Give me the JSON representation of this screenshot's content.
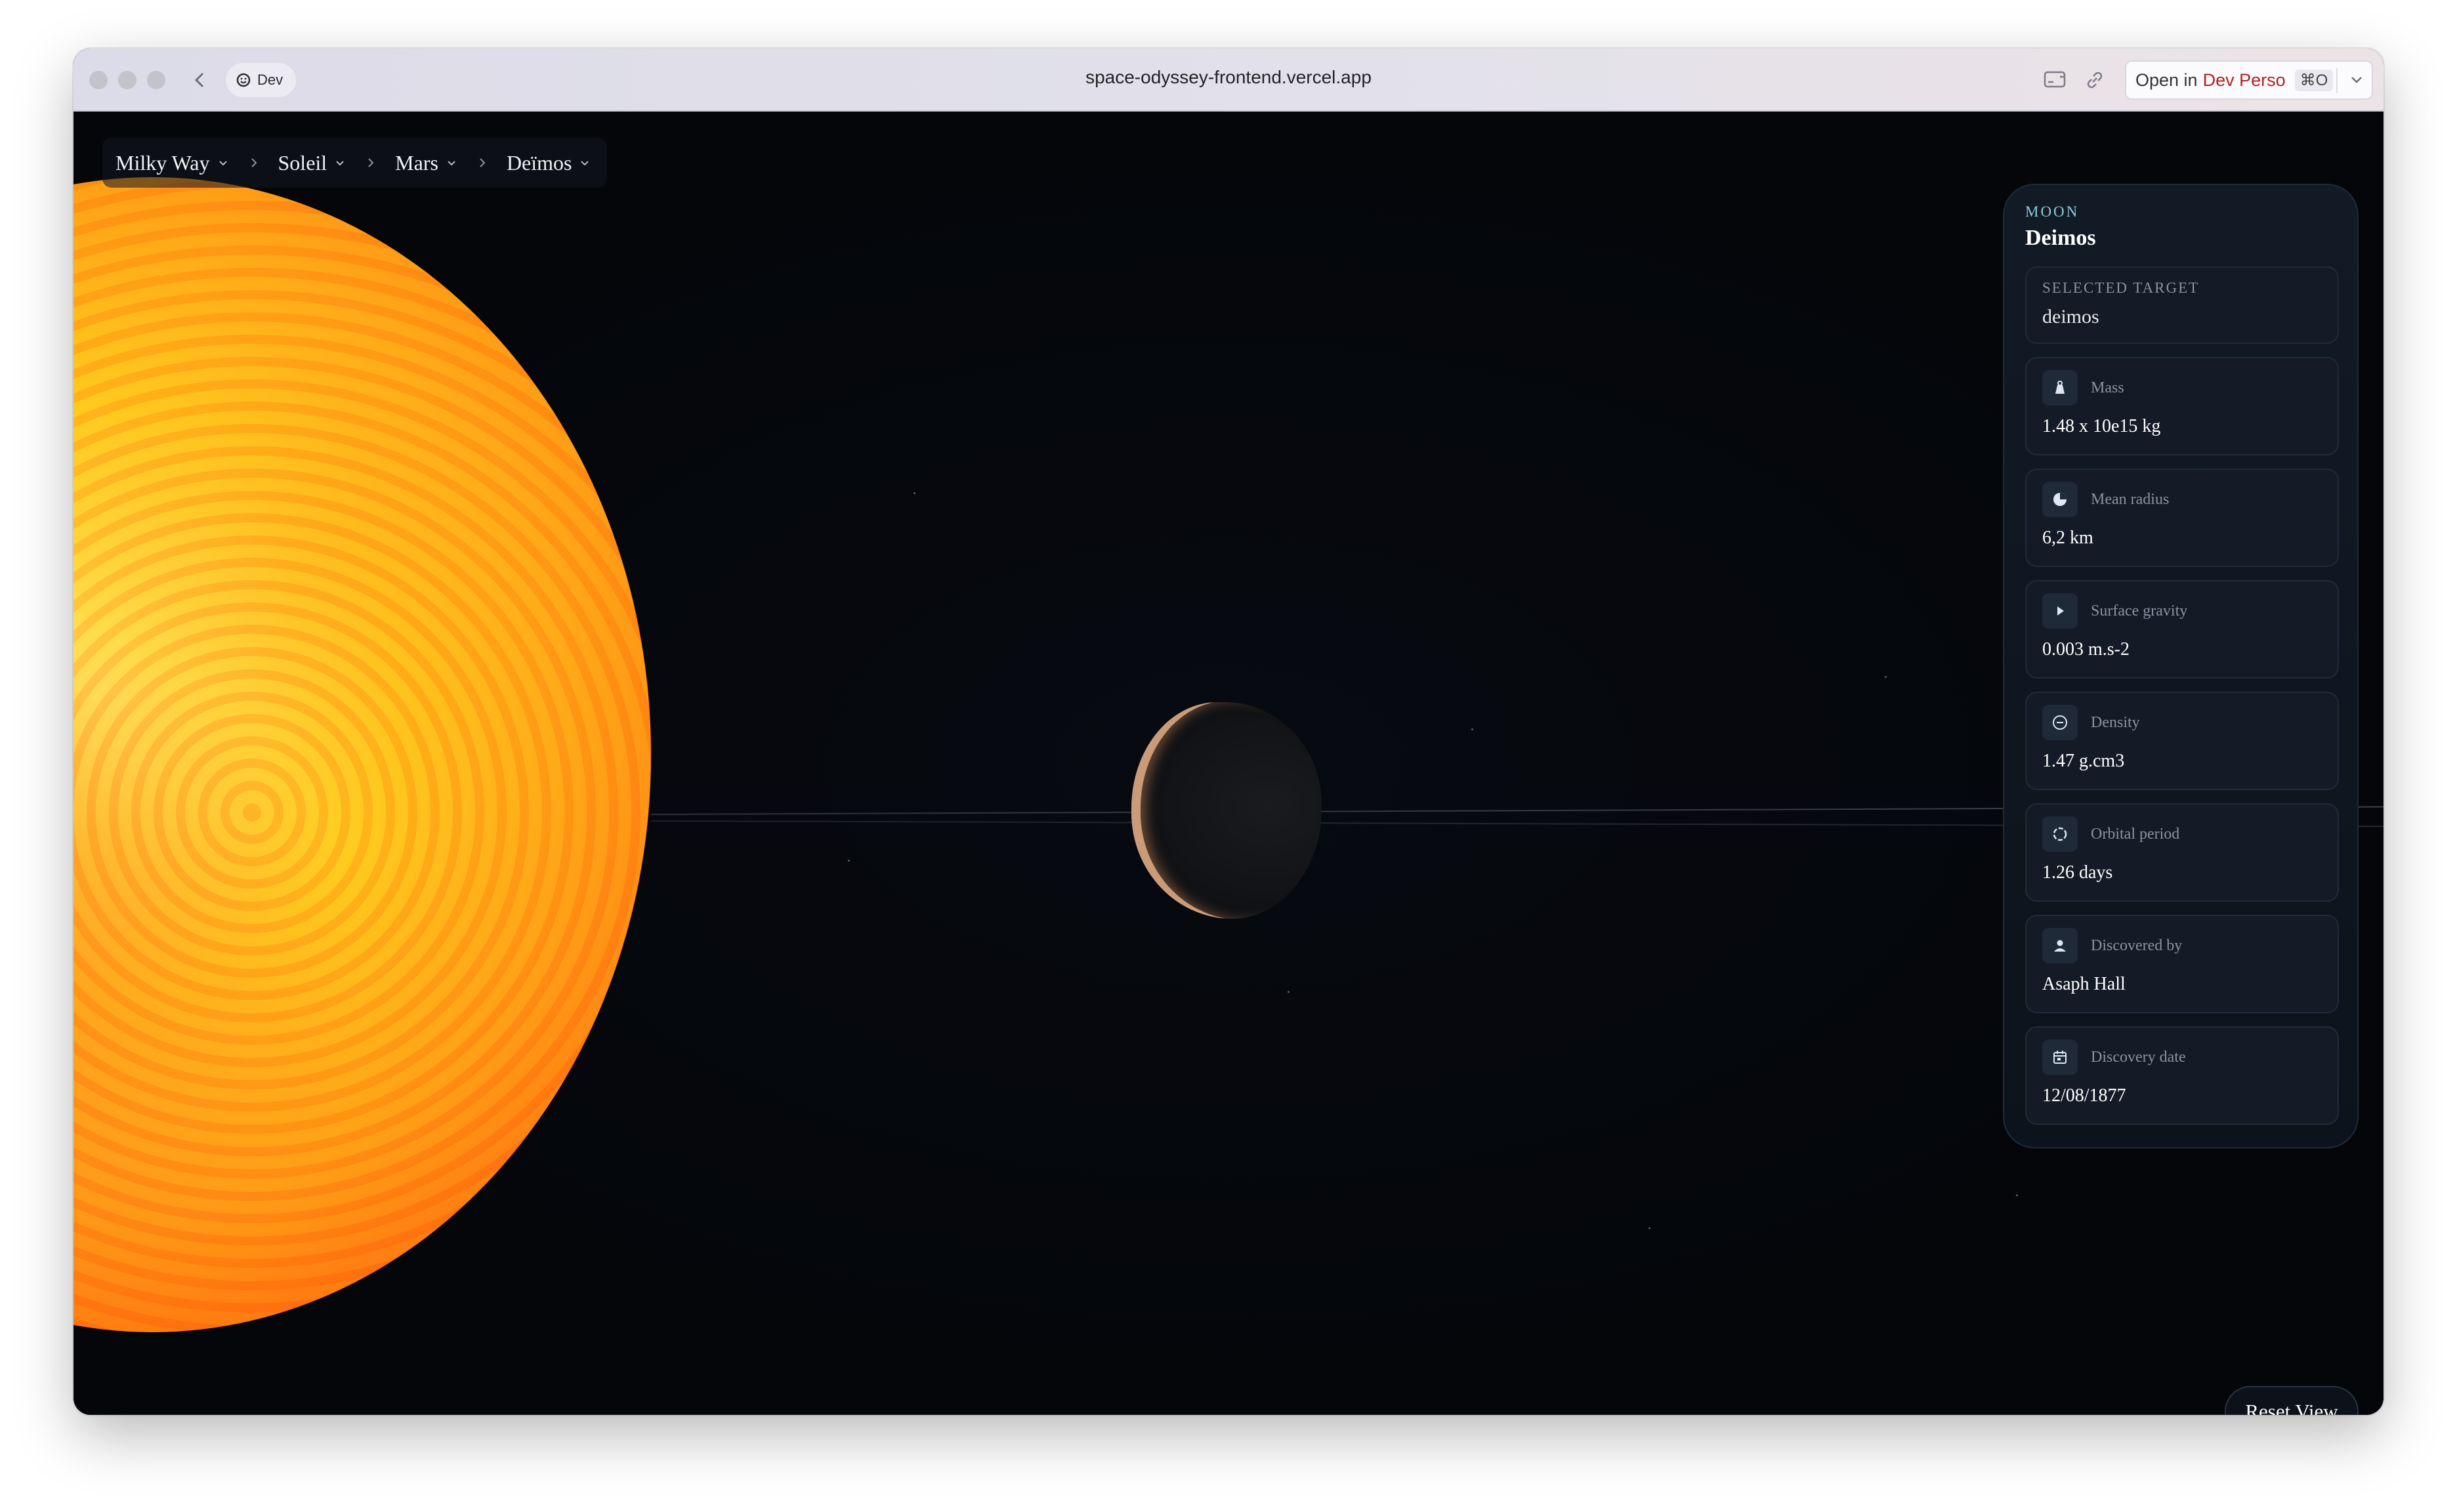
{
  "browser": {
    "profile_label": "Dev",
    "url": "space-odyssey-frontend.vercel.app",
    "open_in_prefix": "Open in",
    "open_in_target": "Dev Perso",
    "open_in_shortcut": "⌘O"
  },
  "breadcrumb": [
    {
      "label": "Milky Way"
    },
    {
      "label": "Soleil"
    },
    {
      "label": "Mars"
    },
    {
      "label": "Deïmos"
    }
  ],
  "panel": {
    "type": "MOON",
    "title": "Deimos",
    "selected_target_label": "SELECTED TARGET",
    "selected_target_value": "deimos",
    "stats": [
      {
        "icon": "mass-icon",
        "label": "Mass",
        "value": "1.48 x 10e15 kg"
      },
      {
        "icon": "radius-icon",
        "label": "Mean radius",
        "value": "6,2 km"
      },
      {
        "icon": "gravity-icon",
        "label": "Surface gravity",
        "value": "0.003 m.s-2"
      },
      {
        "icon": "density-icon",
        "label": "Density",
        "value": "1.47 g.cm3"
      },
      {
        "icon": "orbit-icon",
        "label": "Orbital period",
        "value": "1.26 days"
      },
      {
        "icon": "person-icon",
        "label": "Discovered by",
        "value": "Asaph Hall"
      },
      {
        "icon": "calendar-icon",
        "label": "Discovery date",
        "value": "12/08/1877"
      }
    ]
  },
  "reset_button_label": "Reset View",
  "colors": {
    "accent": "#8ecbe0",
    "background": "#05070b",
    "panel": "#121a26"
  }
}
